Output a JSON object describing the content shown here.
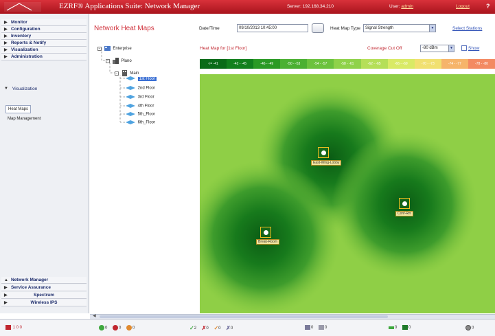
{
  "header": {
    "logo_text": "senti",
    "app_title": "EZRF® Applications Suite: Network Manager",
    "server_label": "Server: 192.168.34.210",
    "user_label": "User:",
    "user_name": "admin",
    "logout": "Logout",
    "help": "?"
  },
  "sidebar": {
    "items": [
      {
        "label": "Monitor"
      },
      {
        "label": "Configuration"
      },
      {
        "label": "Inventory"
      },
      {
        "label": "Reports & Notify"
      },
      {
        "label": "Visualization"
      },
      {
        "label": "Administration"
      }
    ],
    "section_title": "Visualization",
    "sub_links": [
      {
        "label": "Heat Maps"
      },
      {
        "label": "Map Management"
      }
    ],
    "bottom_items": [
      {
        "label": "Network Manager"
      },
      {
        "label": "Service Assurance"
      },
      {
        "label": "Spectrum"
      },
      {
        "label": "Wireless IPS"
      }
    ]
  },
  "page": {
    "title": "Network Heat Maps",
    "datetime_label": "Date/Time",
    "datetime_value": "09/10/2013 10:45:00",
    "heatmap_type_label": "Heat Map Type",
    "heatmap_type_value": "Signal Strength",
    "select_stations": "Select Stations"
  },
  "tree": {
    "root": "Enterprise",
    "campus": "Plano",
    "building": "Main",
    "floors": [
      "1st Floor",
      "2nd Floor",
      "3rd Floor",
      "4th Floor",
      "5th_Floor",
      "6th_Floor"
    ],
    "selected_floor": "1st Floor"
  },
  "heatmap": {
    "title": "Heat Map for [1st Floor]",
    "coverage_label": "Coverage Cut Off",
    "coverage_value": "-80 dBm",
    "show_label": "Show",
    "legend": [
      {
        "label": "<= -41",
        "color": "#0a6b18"
      },
      {
        "label": "-42 - -45",
        "color": "#12801e"
      },
      {
        "label": "-46 - -49",
        "color": "#2a9a25"
      },
      {
        "label": "-50 - -53",
        "color": "#4bb032"
      },
      {
        "label": "-54 - -57",
        "color": "#6cc23e"
      },
      {
        "label": "-58 - -61",
        "color": "#8fd24a"
      },
      {
        "label": "-62 - -65",
        "color": "#b5df58"
      },
      {
        "label": "-66 - -69",
        "color": "#d9ea66"
      },
      {
        "label": "-70 - -73",
        "color": "#f1e070"
      },
      {
        "label": "-74 - -77",
        "color": "#f6b46a"
      },
      {
        "label": "-78 - -80",
        "color": "#f38a62"
      }
    ],
    "access_points": [
      {
        "label": "East-Wing-Lobby"
      },
      {
        "label": "Conf-Rm"
      },
      {
        "label": "Break-Room"
      }
    ]
  },
  "statusbar": {
    "counts_critical": "1  0  0",
    "group1": [
      "0",
      "0",
      "0"
    ],
    "group2": [
      "2",
      "0",
      "0",
      "0"
    ],
    "group3": [
      "0",
      "0"
    ],
    "group4": [
      "0",
      "0"
    ],
    "group5": "0"
  }
}
